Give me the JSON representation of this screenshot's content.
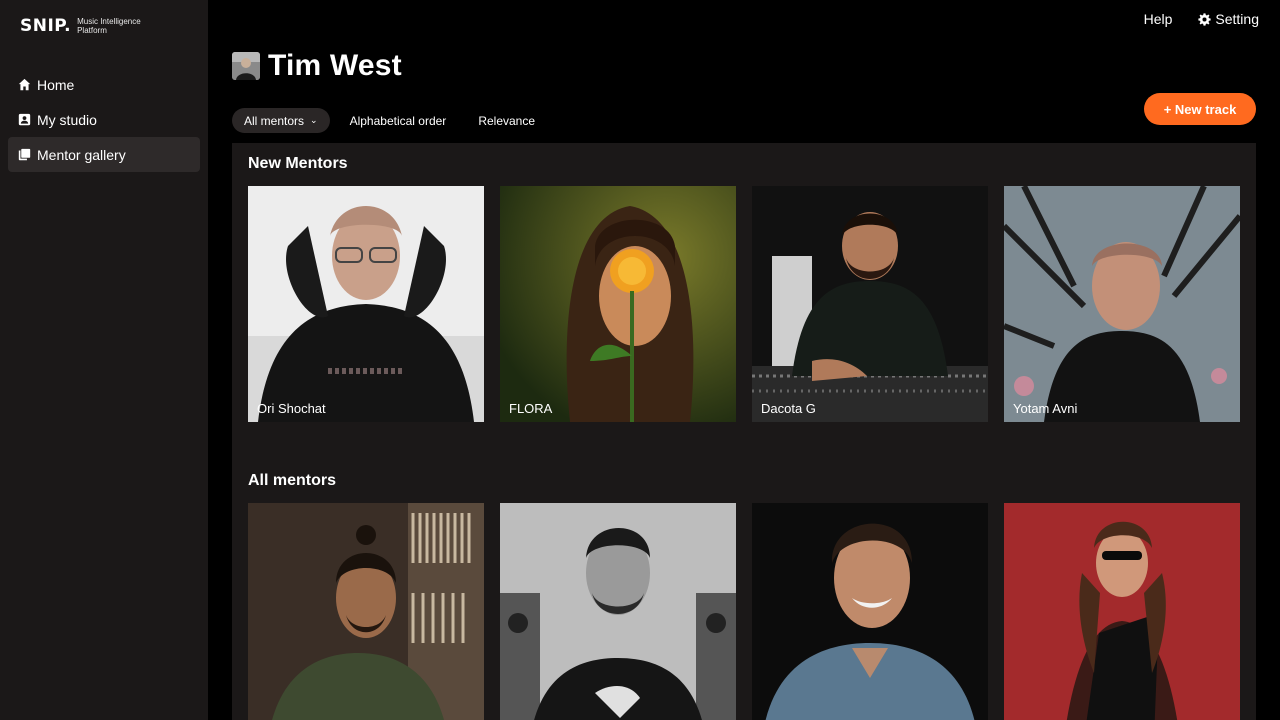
{
  "brand": {
    "name": "SNIP.",
    "tagline": "Music Intelligence Platform"
  },
  "nav": [
    {
      "label": "Home",
      "icon": "home-icon"
    },
    {
      "label": "My studio",
      "icon": "user-badge-icon"
    },
    {
      "label": "Mentor gallery",
      "icon": "gallery-icon",
      "active": true
    }
  ],
  "topbar": {
    "help": "Help",
    "setting": "Setting"
  },
  "profile": {
    "name": "Tim West"
  },
  "filters": {
    "dropdown_value": "All mentors",
    "sort_alpha": "Alphabetical order",
    "sort_relevance": "Relevance"
  },
  "actions": {
    "new_track": "+ New track"
  },
  "colors": {
    "accent": "#ff6a1f",
    "sidebar": "#1b1818",
    "background": "#000000"
  },
  "sections": {
    "new_mentors": {
      "title": "New Mentors",
      "cards": [
        {
          "name": "Ori Shochat"
        },
        {
          "name": "FLORA"
        },
        {
          "name": "Dacota G"
        },
        {
          "name": "Yotam Avni"
        }
      ]
    },
    "all_mentors": {
      "title": "All mentors",
      "cards": [
        {
          "name": ""
        },
        {
          "name": ""
        },
        {
          "name": ""
        },
        {
          "name": ""
        }
      ]
    }
  }
}
